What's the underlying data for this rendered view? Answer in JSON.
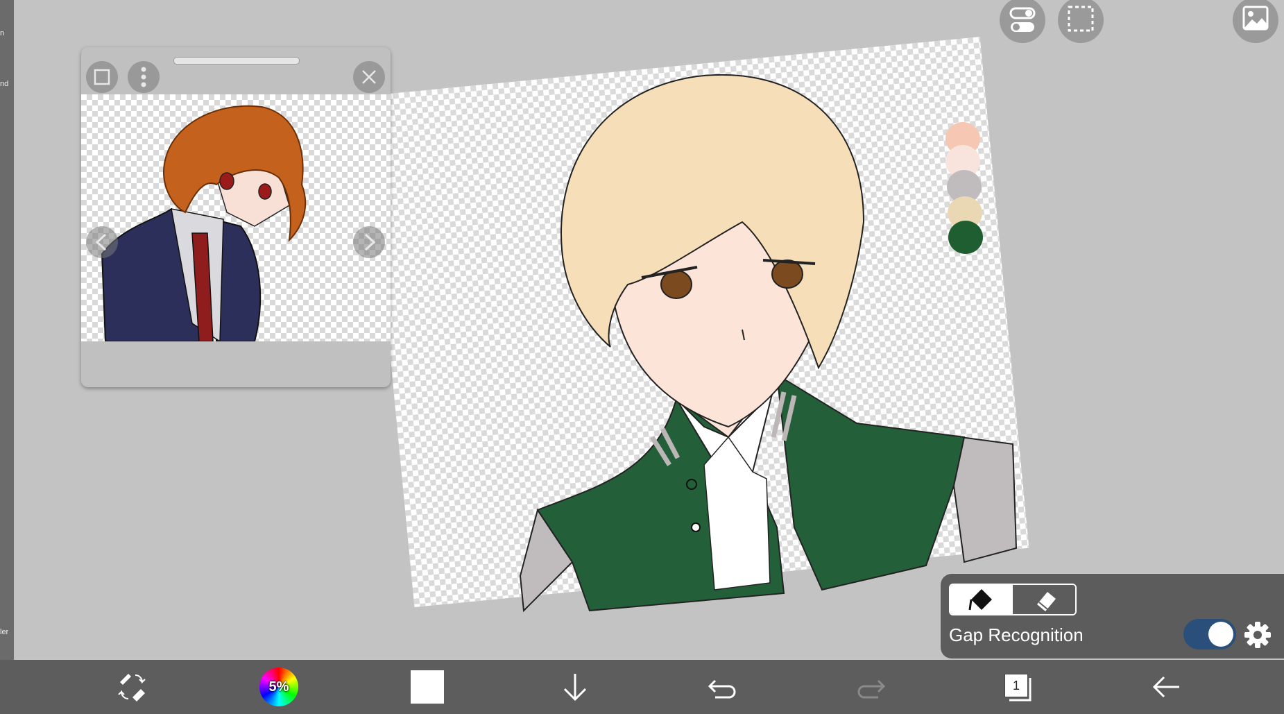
{
  "left_strip": {
    "fragments": [
      "n",
      "nd",
      "ler",
      "er"
    ]
  },
  "top_buttons": [
    {
      "name": "toggle-settings-icon"
    },
    {
      "name": "selection-icon"
    },
    {
      "name": "image-icon"
    }
  ],
  "reference_window": {
    "buttons": [
      "window-icon",
      "more-icon",
      "close-icon",
      "prev-icon",
      "next-icon"
    ]
  },
  "palette": [
    "#f6c8b4",
    "#f8e4dc",
    "#c0bcbe",
    "#ead8b4",
    "#1f5e31"
  ],
  "fill_panel": {
    "gap_label": "Gap Recognition",
    "gap_recognition_on": true,
    "mode_selected": "fill"
  },
  "bottom_bar": {
    "brush_size_label": "5%",
    "current_color": "#ffffff",
    "layer_count": "1"
  },
  "colors": {
    "background": "#c3c3c3",
    "bottom_bar": "#5d5d5d",
    "panel": "#5c5c5c",
    "toggle_on": "#2a4f7a",
    "jacket_green": "#235f38",
    "hair": "#f6deb8"
  }
}
